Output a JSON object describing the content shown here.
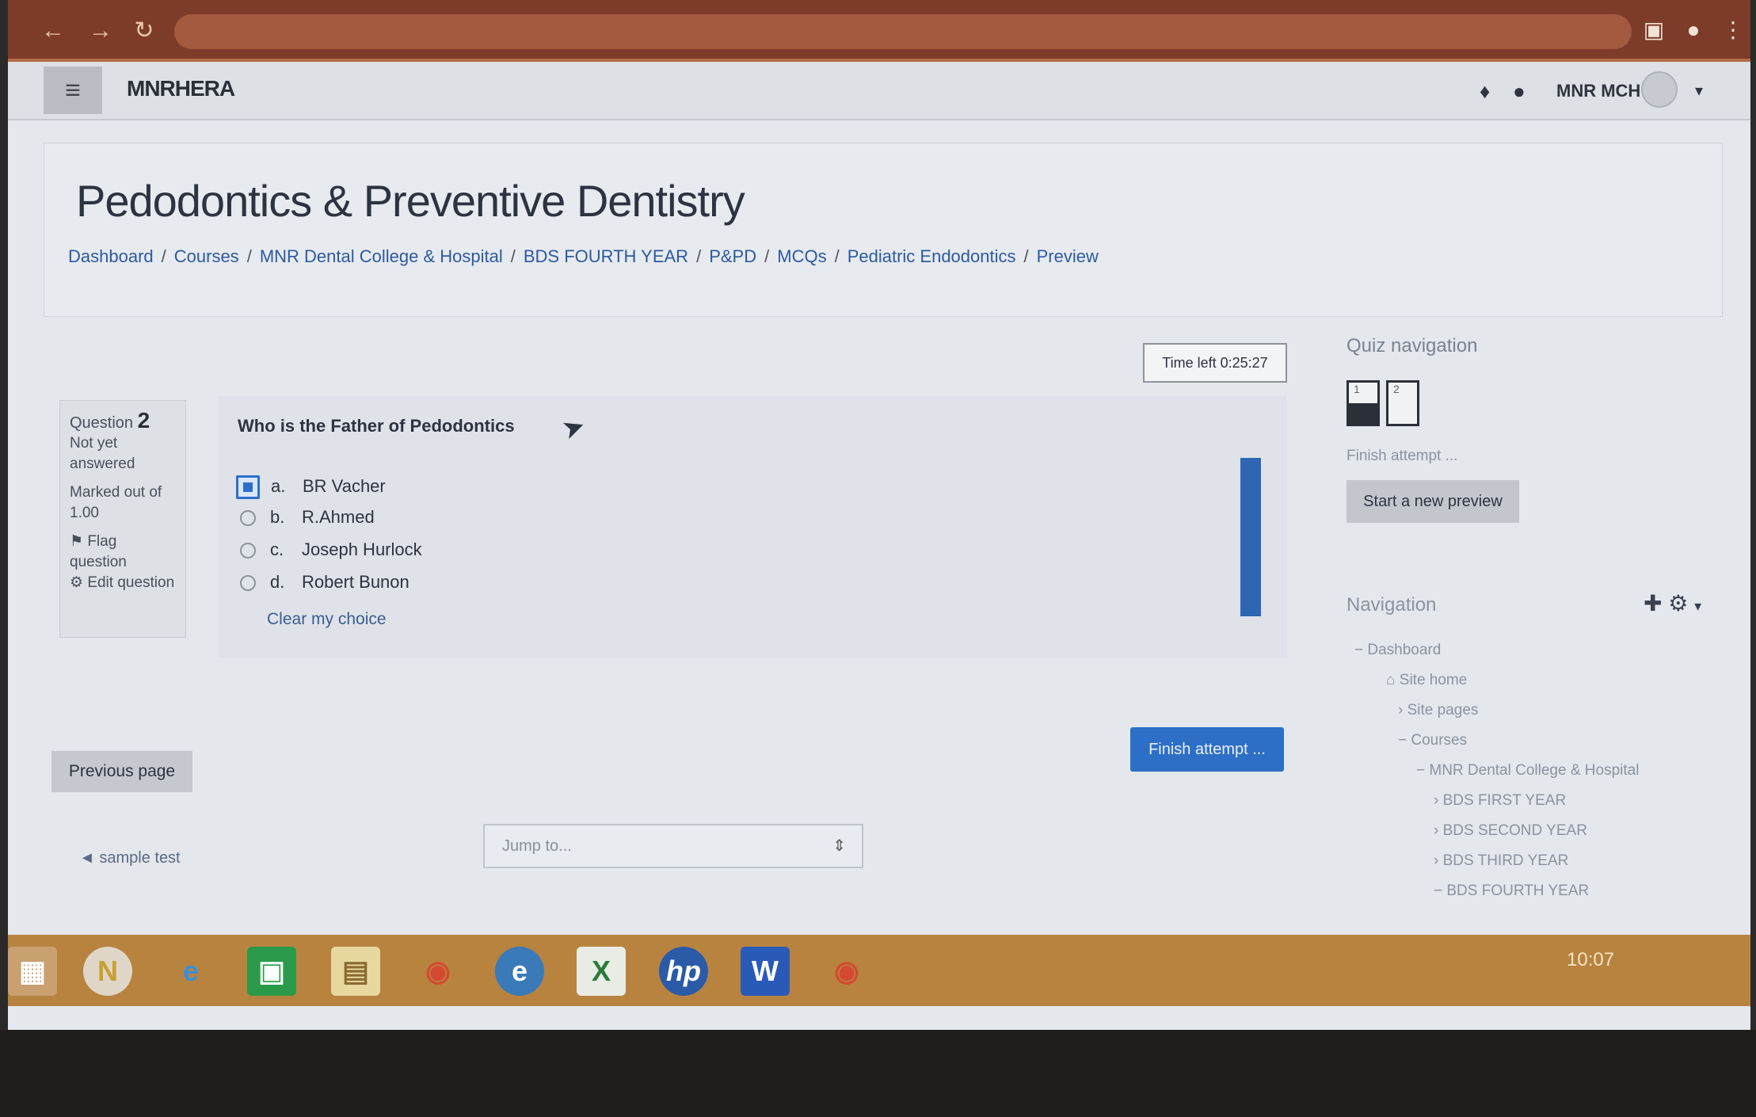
{
  "browser": {
    "url": "",
    "icons": [
      "back-icon",
      "forward-icon",
      "reload-icon",
      "extension-icon",
      "profile-icon",
      "menu-icon"
    ]
  },
  "navbar": {
    "site_name": "MNRHERA",
    "user_name": "MNR MCH"
  },
  "header": {
    "title": "Pedodontics & Preventive Dentistry",
    "breadcrumb": [
      "Dashboard",
      "Courses",
      "MNR Dental College & Hospital",
      "BDS FOURTH YEAR",
      "P&PD",
      "MCQs",
      "Pediatric Endodontics",
      "Preview"
    ]
  },
  "question_info": {
    "label": "Question",
    "number": "2",
    "status": "Not yet answered",
    "marks": "Marked out of 1.00",
    "flag": "Flag question",
    "edit": "Edit question"
  },
  "question": {
    "text": "Who is the Father of Pedodontics",
    "options": [
      {
        "letter": "a.",
        "text": "BR Vacher",
        "selected": true
      },
      {
        "letter": "b.",
        "text": "R.Ahmed",
        "selected": false
      },
      {
        "letter": "c.",
        "text": "Joseph Hurlock",
        "selected": false
      },
      {
        "letter": "d.",
        "text": "Robert Bunon",
        "selected": false
      }
    ],
    "clear_choice": "Clear my choice"
  },
  "timer": "Time left 0:25:27",
  "buttons": {
    "finish_attempt": "Finish attempt ...",
    "previous_page": "Previous page",
    "prev_link": "◄ sample test",
    "jump_to": "Jump to..."
  },
  "quiz_navigation": {
    "title": "Quiz navigation",
    "boxes": [
      "1",
      "2"
    ],
    "finish_link": "Finish attempt ...",
    "new_preview": "Start a new preview"
  },
  "navigation": {
    "title": "Navigation",
    "items": [
      {
        "text": "− Dashboard",
        "level": 0
      },
      {
        "text": "Site home",
        "level": 1
      },
      {
        "text": "› Site pages",
        "level": 2
      },
      {
        "text": "− Courses",
        "level": 2
      },
      {
        "text": "− MNR Dental College & Hospital",
        "level": 3
      },
      {
        "text": "› BDS FIRST YEAR",
        "level": 4
      },
      {
        "text": "› BDS SECOND YEAR",
        "level": 4
      },
      {
        "text": "› BDS THIRD YEAR",
        "level": 4
      },
      {
        "text": "− BDS FOURTH YEAR",
        "level": 4
      }
    ]
  },
  "taskbar": {
    "apps": [
      "windows-start-icon",
      "norton-icon",
      "internet-explorer-icon",
      "store-icon",
      "file-explorer-icon",
      "chrome-icon",
      "edge-icon",
      "excel-icon",
      "hp-icon",
      "word-icon",
      "chrome-icon"
    ],
    "clock": "10:07"
  },
  "colors": {
    "accent": "#2d6fc6",
    "link": "#2d5aa0",
    "taskbar": "#b8833f"
  }
}
